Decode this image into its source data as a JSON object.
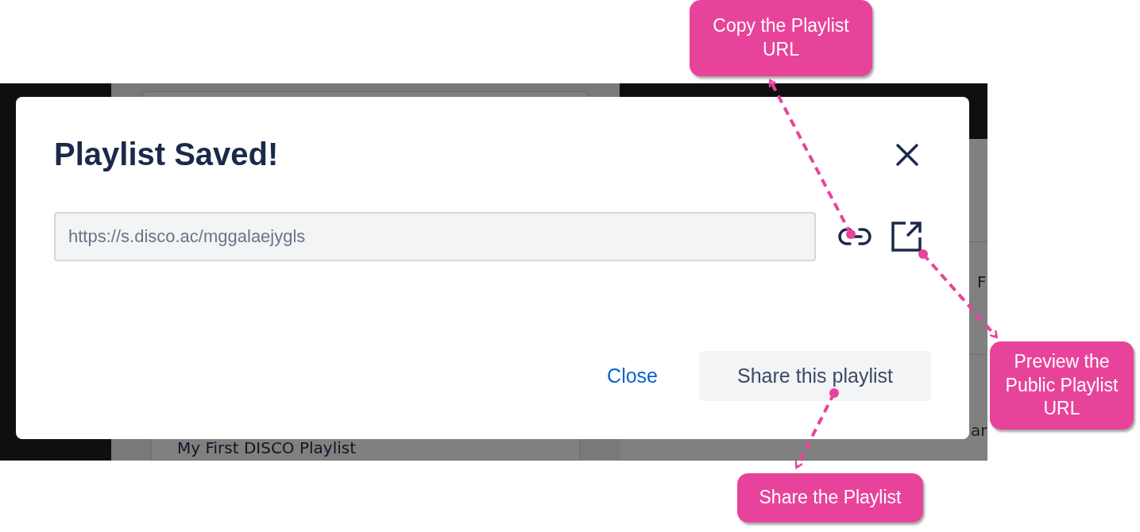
{
  "background": {
    "playlist_name": "My First DISCO Playlist",
    "fragments": [
      "F",
      "ar"
    ]
  },
  "modal": {
    "title": "Playlist Saved!",
    "url": "https://s.disco.ac/mggalaejygls",
    "close_link": "Close",
    "share_button": "Share this playlist"
  },
  "callouts": [
    {
      "text": "Copy the Playlist URL"
    },
    {
      "text": "Preview the Public Playlist URL"
    },
    {
      "text": "Share the Playlist"
    }
  ]
}
